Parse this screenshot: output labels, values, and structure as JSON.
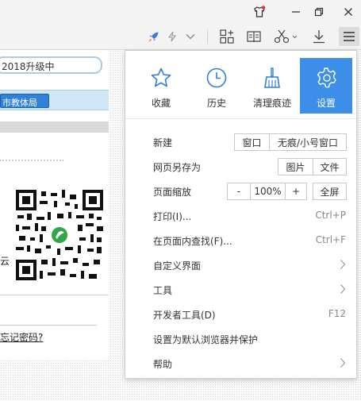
{
  "window": {
    "skin_icon": "shirt-icon",
    "restore_icon": "restore-window-icon",
    "close_icon": "close-icon"
  },
  "toolbar": {
    "icons": [
      "rocket-icon",
      "lightning-icon",
      "chevron-down-icon",
      "grid-plus-icon",
      "reader-icon",
      "scissors-icon",
      "download-icon",
      "hamburger-menu-icon"
    ]
  },
  "page": {
    "search_text": "2018升级中",
    "tab_label": "市教体局",
    "side_text": "云",
    "link_text": "忘记密码?"
  },
  "menu": {
    "quick": [
      {
        "label": "收藏",
        "icon": "star-icon"
      },
      {
        "label": "历史",
        "icon": "clock-icon"
      },
      {
        "label": "清理痕迹",
        "icon": "broom-icon"
      },
      {
        "label": "设置",
        "icon": "gear-icon"
      }
    ],
    "new": {
      "label": "新建",
      "window": "窗口",
      "incognito": "无痕/小号窗口"
    },
    "save_as": {
      "label": "网页另存为",
      "image": "图片",
      "file": "文件"
    },
    "zoom": {
      "label": "页面缩放",
      "minus": "-",
      "value": "100%",
      "plus": "+",
      "fullscreen": "全屏"
    },
    "print": {
      "label": "打印(I)...",
      "shortcut": "Ctrl+P"
    },
    "find": {
      "label": "在页面内查找(F)...",
      "shortcut": "Ctrl+F"
    },
    "customize": {
      "label": "自定义界面"
    },
    "tools": {
      "label": "工具"
    },
    "devtools": {
      "label": "开发者工具(D)",
      "shortcut": "F12"
    },
    "default_browser": {
      "label": "设置为默认浏览器并保护"
    },
    "help": {
      "label": "帮助"
    }
  },
  "colors": {
    "accent": "#3d8ee9",
    "icon_blue": "#2f7fd8",
    "notify_red": "#e33"
  }
}
